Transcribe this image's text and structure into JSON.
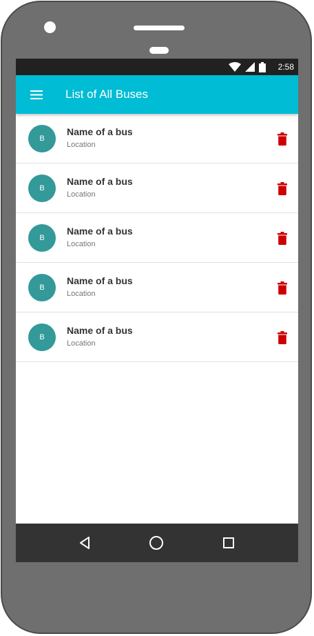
{
  "status_bar": {
    "time": "2:58",
    "icons": [
      "wifi-icon",
      "signal-icon",
      "battery-icon"
    ]
  },
  "app_bar": {
    "title": "List of All Buses",
    "menu_icon": "menu-icon",
    "color": "#00bcd4"
  },
  "buses": [
    {
      "avatar": "B",
      "name": "Name of a bus",
      "location": "Location"
    },
    {
      "avatar": "B",
      "name": "Name of a bus",
      "location": "Location"
    },
    {
      "avatar": "B",
      "name": "Name of a bus",
      "location": "Location"
    },
    {
      "avatar": "B",
      "name": "Name of a bus",
      "location": "Location"
    },
    {
      "avatar": "B",
      "name": "Name of a bus",
      "location": "Location"
    }
  ],
  "colors": {
    "avatar": "#339999",
    "delete": "#cc0000",
    "status_bar": "#212121",
    "nav_bar": "#333333"
  },
  "nav_bar": {
    "icons": [
      "back-icon",
      "home-icon",
      "recents-icon"
    ]
  }
}
